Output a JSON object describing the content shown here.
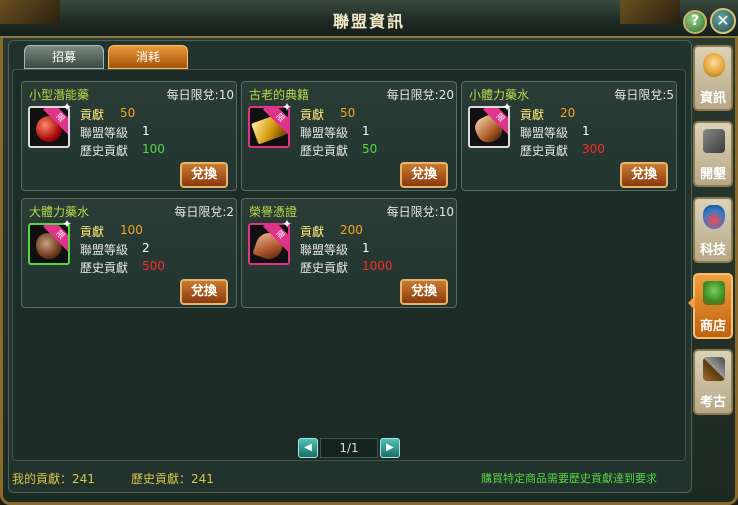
{
  "window": {
    "title": "聯盟資訊",
    "help_icon": "?",
    "close_icon": "✕"
  },
  "tabs": [
    {
      "label": "招募",
      "active": false
    },
    {
      "label": "消耗",
      "active": true
    }
  ],
  "item_labels": {
    "contribution": "貢獻",
    "alliance_level": "聯盟等級",
    "history_contribution": "歷史貢獻",
    "exchange_button": "兌換",
    "limited_badge": "限"
  },
  "items": [
    {
      "name": "小型潛能藥",
      "limit": "每日限兌:10",
      "contribution": "50",
      "alliance_level": "1",
      "history_contribution": "100",
      "history_color": "#56d645",
      "icon": "red-potion-icon"
    },
    {
      "name": "古老的典籍",
      "limit": "每日限兌:20",
      "contribution": "50",
      "alliance_level": "1",
      "history_contribution": "50",
      "history_color": "#56d645",
      "icon": "gold-book-icon"
    },
    {
      "name": "小體力藥水",
      "limit": "每日限兌:5",
      "contribution": "20",
      "alliance_level": "1",
      "history_contribution": "300",
      "history_color": "#ff2a2a",
      "icon": "small-stamina-potion-icon"
    },
    {
      "name": "大體力藥水",
      "limit": "每日限兌:2",
      "contribution": "100",
      "alliance_level": "2",
      "history_contribution": "500",
      "history_color": "#ff2a2a",
      "icon": "large-stamina-potion-icon"
    },
    {
      "name": "榮譽憑證",
      "limit": "每日限兌:10",
      "contribution": "200",
      "alliance_level": "1",
      "history_contribution": "1000",
      "history_color": "#ff2a2a",
      "icon": "honor-token-icon"
    }
  ],
  "pager": {
    "page_text": "1/1",
    "prev_icon": "◀",
    "next_icon": "▶"
  },
  "footer": {
    "my_contribution": "我的貢獻：241",
    "history_contribution": "歷史貢獻：241",
    "note": "購買特定商品需要歷史貢獻達到要求"
  },
  "side_nav": [
    {
      "label": "資訊",
      "icon": "portrait-icon",
      "active": false
    },
    {
      "label": "開墾",
      "icon": "pickaxe-icon",
      "active": false
    },
    {
      "label": "科技",
      "icon": "flask-icon",
      "active": false
    },
    {
      "label": "商店",
      "icon": "shop-icon",
      "active": true
    },
    {
      "label": "考古",
      "icon": "hammer-icon",
      "active": false
    }
  ]
}
